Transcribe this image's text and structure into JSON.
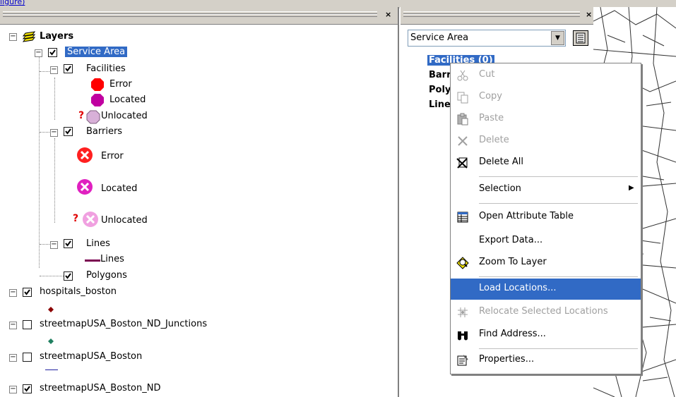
{
  "top": {
    "link_fragment": "ligure)"
  },
  "toc": {
    "root_label": "Layers",
    "items": {
      "service_area": "Service Area",
      "facilities": "Facilities",
      "fac_error": "Error",
      "fac_located": "Located",
      "fac_unlocated": "Unlocated",
      "barriers": "Barriers",
      "bar_error": "Error",
      "bar_located": "Located",
      "bar_unlocated": "Unlocated",
      "lines": "Lines",
      "lines_symbol": "Lines",
      "polygons": "Polygons",
      "hospitals": "hospitals_boston",
      "junctions": "streetmapUSA_Boston_ND_Junctions",
      "streetmap": "streetmapUSA_Boston",
      "streetmap_nd": "streetmapUSA_Boston_ND"
    },
    "colors": {
      "fac_error": "#ff0000",
      "fac_located": "#c000a0",
      "fac_unlocated": "#d8b0d8",
      "bar_error": "#ff2020",
      "bar_located": "#e020c0",
      "bar_unlocated": "#f0a0e0",
      "lines_symbol": "#7a0050",
      "hospitals": "#8b0000",
      "junctions": "#208060",
      "streetmap": "#2020a0",
      "selection": "#316ac5"
    }
  },
  "mid": {
    "dropdown_value": "Service Area",
    "items": [
      "Facilities (0)",
      "Barr",
      "Poly",
      "Line"
    ]
  },
  "context_menu": {
    "items": [
      {
        "label": "Cut",
        "icon": "scissors-icon",
        "enabled": false
      },
      {
        "label": "Copy",
        "icon": "copy-icon",
        "enabled": false
      },
      {
        "label": "Paste",
        "icon": "paste-icon",
        "enabled": false
      },
      {
        "label": "Delete",
        "icon": "delete-x-icon",
        "enabled": false
      },
      {
        "label": "Delete All",
        "icon": "delete-all-icon",
        "enabled": true
      },
      {
        "label": "Selection",
        "icon": "",
        "enabled": true,
        "submenu": true
      },
      {
        "label": "Open Attribute Table",
        "icon": "table-icon",
        "enabled": true
      },
      {
        "label": "Export Data...",
        "icon": "",
        "enabled": true
      },
      {
        "label": "Zoom To Layer",
        "icon": "zoom-to-layer-icon",
        "enabled": true
      },
      {
        "label": "Load Locations...",
        "icon": "",
        "enabled": true,
        "highlighted": true
      },
      {
        "label": "Relocate Selected Locations",
        "icon": "relocate-icon",
        "enabled": false
      },
      {
        "label": "Find Address...",
        "icon": "binoculars-icon",
        "enabled": true
      },
      {
        "label": "Properties...",
        "icon": "properties-icon",
        "enabled": true
      }
    ]
  }
}
